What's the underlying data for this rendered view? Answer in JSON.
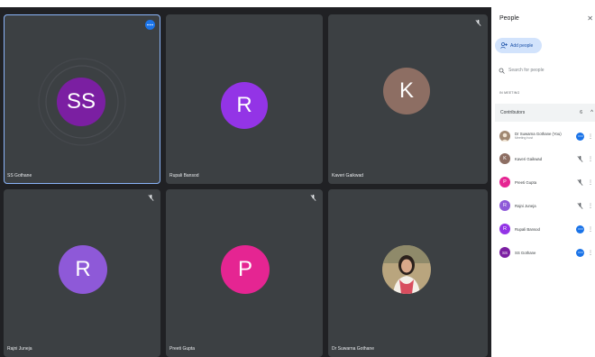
{
  "colors": {
    "tile_bg": "#3c4043",
    "stage_bg": "#202124",
    "accent": "#1a73e8",
    "purple_dark": "#7b1fa2",
    "purple_light": "#9334e6",
    "violet": "#8e59d8",
    "pink": "#e52592",
    "brown": "#8d6e63"
  },
  "tiles": [
    {
      "name": "SS Gothane",
      "initials": "SS",
      "icon": "more-icon"
    },
    {
      "name": "Rupali Bansod",
      "initials": "R",
      "icon": ""
    },
    {
      "name": "Kaveri Gaikwad",
      "initials": "K",
      "icon": "mic-off-icon"
    },
    {
      "name": "Rajni Juneja",
      "initials": "R",
      "icon": "mic-off-icon"
    },
    {
      "name": "Preeti Gupta",
      "initials": "P",
      "icon": "mic-off-icon"
    },
    {
      "name": "Dr Suwarna Gothane",
      "initials": "",
      "icon": ""
    }
  ],
  "panel": {
    "title": "People",
    "close_icon": "close-icon",
    "add_people_label": "Add people",
    "search_placeholder": "Search for people",
    "section_label": "IN MEETING",
    "group_label": "Contributors",
    "group_count": "6",
    "participants": [
      {
        "name": "Dr Suwarna Gothane (You)",
        "subtitle": "Meeting host",
        "initial": "",
        "status": "more"
      },
      {
        "name": "Kaveri Gaikwad",
        "subtitle": "",
        "initial": "K",
        "status": "mic-off"
      },
      {
        "name": "Preeti Gupta",
        "subtitle": "",
        "initial": "P",
        "status": "mic-off"
      },
      {
        "name": "Rajni Juneja",
        "subtitle": "",
        "initial": "R",
        "status": "mic-off"
      },
      {
        "name": "Rupali Bansod",
        "subtitle": "",
        "initial": "R",
        "status": "more"
      },
      {
        "name": "SS Gothane",
        "subtitle": "",
        "initial": "SS",
        "status": "more"
      }
    ]
  }
}
